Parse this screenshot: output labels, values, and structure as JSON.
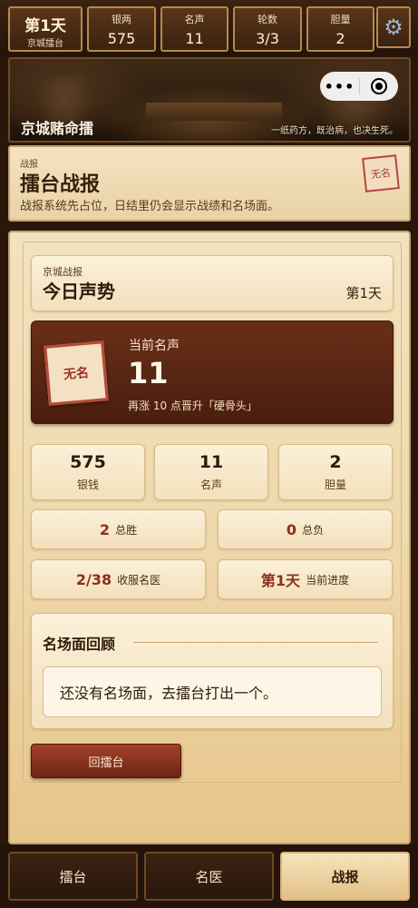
{
  "top_stats": {
    "day": {
      "value": "第1天",
      "label": "京城擂台"
    },
    "items": [
      {
        "label": "银两",
        "value": "575"
      },
      {
        "label": "名声",
        "value": "11"
      },
      {
        "label": "轮数",
        "value": "3/3"
      },
      {
        "label": "胆量",
        "value": "2"
      }
    ],
    "settings_icon": "gear-icon"
  },
  "banner": {
    "title": "京城赌命擂",
    "subtitle": "一纸药方，既治病，也决生死。",
    "more_label": "•••",
    "close_icon": "record-close-icon"
  },
  "section": {
    "kicker": "战报",
    "title": "擂台战报",
    "description": "战报系统先占位，日结里仍会显示战绩和名场面。",
    "seal": "无名"
  },
  "today": {
    "kicker": "京城战报",
    "title": "今日声势",
    "day": "第1天"
  },
  "fame": {
    "seal": "无名",
    "label": "当前名声",
    "value": "11",
    "next": "再涨 10 点晋升「硬骨头」"
  },
  "mini_stats": [
    {
      "value": "575",
      "label": "银钱"
    },
    {
      "value": "11",
      "label": "名声"
    },
    {
      "value": "2",
      "label": "胆量"
    }
  ],
  "record": {
    "wins": {
      "value": "2",
      "label": "总胜"
    },
    "losses": {
      "value": "0",
      "label": "总负"
    },
    "doctors": {
      "value": "2/38",
      "label": "收服名医"
    },
    "progress": {
      "value": "第1天",
      "label": "当前进度"
    }
  },
  "review": {
    "title": "名场面回顾",
    "empty": "还没有名场面，去擂台打出一个。"
  },
  "back_button": "回擂台",
  "nav": {
    "tabs": [
      {
        "label": "擂台",
        "active": false
      },
      {
        "label": "名医",
        "active": false
      },
      {
        "label": "战报",
        "active": true
      }
    ]
  }
}
